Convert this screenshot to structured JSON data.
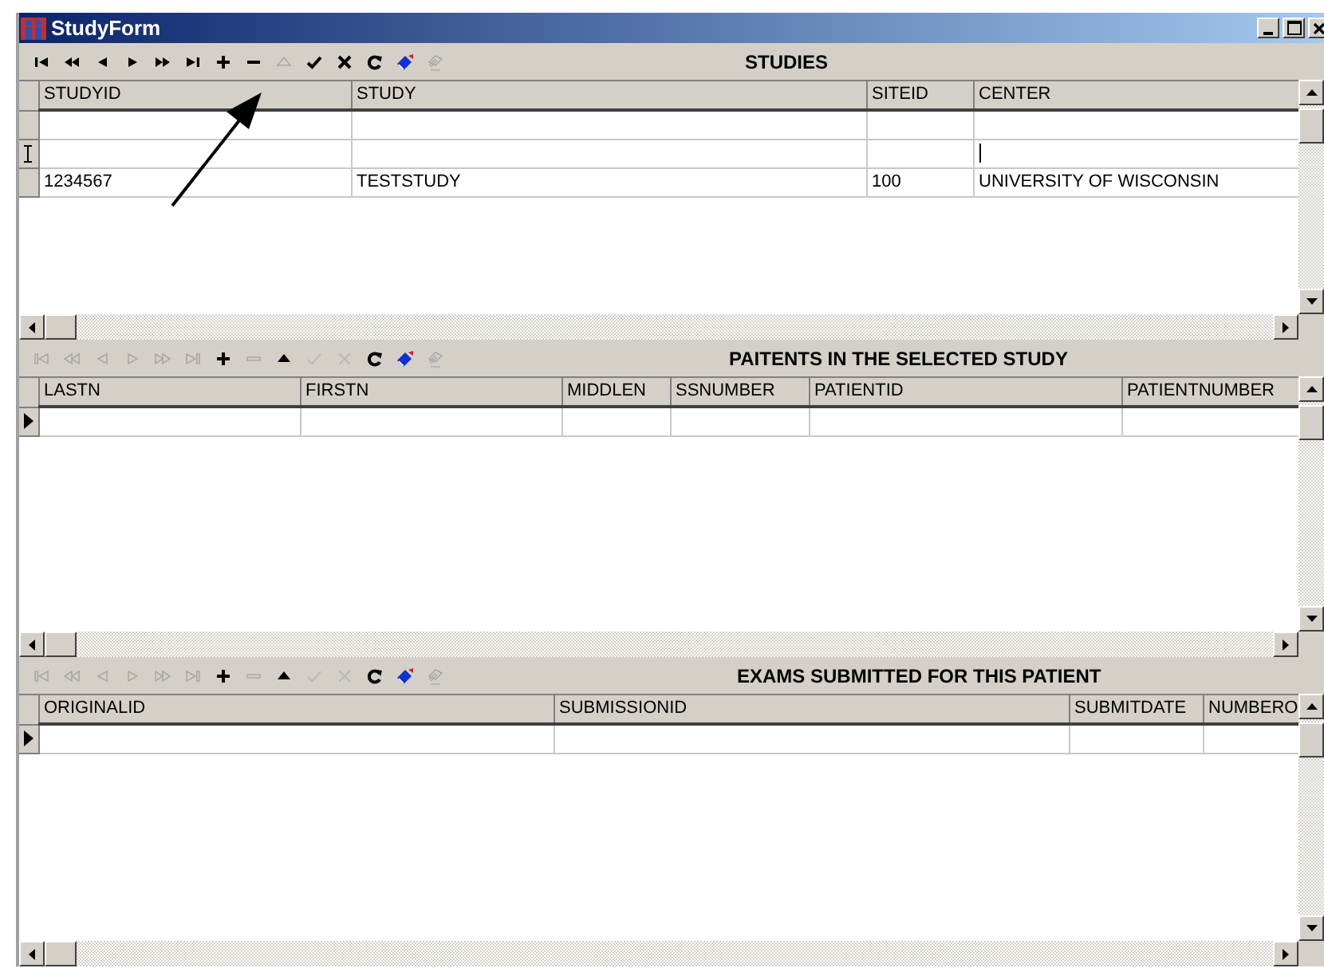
{
  "window": {
    "title": "StudyForm"
  },
  "annotation_arrow": true,
  "sections": [
    {
      "title": "STUDIES",
      "toolbar": [
        {
          "kind": "first",
          "enabled": true
        },
        {
          "kind": "prior",
          "enabled": true
        },
        {
          "kind": "previous",
          "enabled": true
        },
        {
          "kind": "next",
          "enabled": true
        },
        {
          "kind": "next-page",
          "enabled": true
        },
        {
          "kind": "last",
          "enabled": true
        },
        {
          "kind": "insert",
          "enabled": true
        },
        {
          "kind": "delete",
          "enabled": true
        },
        {
          "kind": "edit",
          "enabled": false
        },
        {
          "kind": "post",
          "enabled": true
        },
        {
          "kind": "cancel",
          "enabled": true
        },
        {
          "kind": "refresh",
          "enabled": true
        },
        {
          "kind": "bookmark",
          "enabled": true
        },
        {
          "kind": "data",
          "enabled": false
        }
      ],
      "columns": [
        "STUDYID",
        "STUDY",
        "SITEID",
        "CENTER"
      ],
      "rows": [
        {
          "current": false,
          "editing": false
        },
        {
          "editing": true
        },
        {
          "current": false,
          "editing": false,
          "cells": [
            "1234567",
            "TESTSTUDY",
            "100",
            "UNIVERSITY OF WISCONSIN"
          ]
        }
      ]
    },
    {
      "title": "PAITENTS IN THE SELECTED STUDY",
      "toolbar": [
        {
          "kind": "first",
          "enabled": false
        },
        {
          "kind": "prior",
          "enabled": false
        },
        {
          "kind": "previous",
          "enabled": false
        },
        {
          "kind": "next",
          "enabled": false
        },
        {
          "kind": "next-page",
          "enabled": false
        },
        {
          "kind": "last",
          "enabled": false
        },
        {
          "kind": "insert",
          "enabled": true
        },
        {
          "kind": "delete",
          "enabled": false
        },
        {
          "kind": "edit",
          "enabled": true
        },
        {
          "kind": "post",
          "enabled": false
        },
        {
          "kind": "cancel",
          "enabled": false
        },
        {
          "kind": "refresh",
          "enabled": true
        },
        {
          "kind": "bookmark",
          "enabled": true
        },
        {
          "kind": "data",
          "enabled": false
        }
      ],
      "columns": [
        "LASTN",
        "FIRSTN",
        "MIDDLEN",
        "SSNUMBER",
        "PATIENTID",
        "PATIENTNUMBER"
      ],
      "rows": [
        {
          "current": true,
          "editing": false
        }
      ]
    },
    {
      "title": "EXAMS SUBMITTED  FOR THIS PATIENT",
      "toolbar": [
        {
          "kind": "first",
          "enabled": false
        },
        {
          "kind": "prior",
          "enabled": false
        },
        {
          "kind": "previous",
          "enabled": false
        },
        {
          "kind": "next",
          "enabled": false
        },
        {
          "kind": "next-page",
          "enabled": false
        },
        {
          "kind": "last",
          "enabled": false
        },
        {
          "kind": "insert",
          "enabled": true
        },
        {
          "kind": "delete",
          "enabled": false
        },
        {
          "kind": "edit",
          "enabled": true
        },
        {
          "kind": "post",
          "enabled": false
        },
        {
          "kind": "cancel",
          "enabled": false
        },
        {
          "kind": "refresh",
          "enabled": true
        },
        {
          "kind": "bookmark",
          "enabled": true
        },
        {
          "kind": "data",
          "enabled": false
        }
      ],
      "columns": [
        "ORIGINALID",
        "SUBMISSIONID",
        "SUBMITDATE",
        "NUMBERO"
      ],
      "rows": [
        {
          "current": true,
          "editing": false
        }
      ]
    }
  ]
}
